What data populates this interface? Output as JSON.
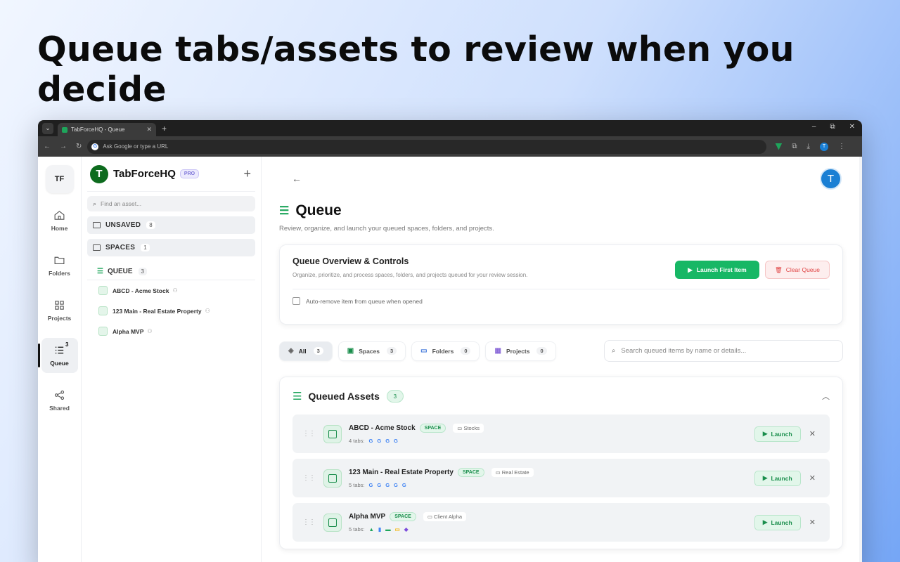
{
  "headline": "Queue tabs/assets to review when you decide",
  "browser": {
    "tab_title": "TabForceHQ - Queue",
    "tab_close": "✕",
    "new_tab": "+",
    "omnibox_placeholder": "Ask Google or type a URL",
    "avatar_initial": "T",
    "window_controls": [
      "–",
      "⧉",
      "✕"
    ]
  },
  "rail": {
    "logo": "TF",
    "items": [
      {
        "label": "Home",
        "icon": "home-icon"
      },
      {
        "label": "Folders",
        "icon": "folder-icon"
      },
      {
        "label": "Projects",
        "icon": "grid-icon"
      },
      {
        "label": "Queue",
        "icon": "list-icon",
        "badge": "3",
        "active": true
      },
      {
        "label": "Shared",
        "icon": "share-icon"
      }
    ]
  },
  "sidebar": {
    "brand": "TabForceHQ",
    "brand_logo": "T",
    "pro": "PRO",
    "add": "+",
    "search_placeholder": "Find an asset...",
    "groups": [
      {
        "label": "UNSAVED",
        "count": "8"
      },
      {
        "label": "SPACES",
        "count": "1"
      }
    ],
    "queue": {
      "label": "QUEUE",
      "count": "3"
    },
    "queue_items": [
      "ABCD - Acme Stock",
      "123 Main - Real Estate Property",
      "Alpha MVP"
    ]
  },
  "main": {
    "back": "←",
    "user_initial": "T",
    "title": "Queue",
    "subtitle": "Review, organize, and launch your queued spaces, folders, and projects.",
    "controls": {
      "title": "Queue Overview & Controls",
      "desc": "Organize, prioritize, and process spaces, folders, and projects queued for your review session.",
      "launch_first": "Launch First Item",
      "clear": "Clear Queue",
      "auto_remove": "Auto-remove item from queue when opened"
    },
    "filters": [
      {
        "label": "All",
        "count": "3",
        "icon": "layers-icon"
      },
      {
        "label": "Spaces",
        "count": "3",
        "icon": "space-icon"
      },
      {
        "label": "Folders",
        "count": "0",
        "icon": "folder-icon"
      },
      {
        "label": "Projects",
        "count": "0",
        "icon": "grid-icon"
      }
    ],
    "search_placeholder": "Search queued items by name or details...",
    "queued": {
      "title": "Queued Assets",
      "count": "3",
      "items": [
        {
          "name": "ABCD - Acme Stock",
          "type": "SPACE",
          "folder": "Stocks",
          "tabs": "4 tabs:",
          "favicons": [
            "G",
            "G",
            "G",
            "G"
          ]
        },
        {
          "name": "123 Main - Real Estate Property",
          "type": "SPACE",
          "folder": "Real Estate",
          "tabs": "5 tabs:",
          "favicons": [
            "G",
            "G",
            "G",
            "G",
            "G"
          ]
        },
        {
          "name": "Alpha MVP",
          "type": "SPACE",
          "folder": "Client Alpha",
          "tabs": "5 tabs:",
          "favicons": [
            "▲",
            "▮",
            "▬",
            "▭",
            "◆"
          ]
        }
      ],
      "launch": "Launch"
    }
  },
  "colors": {
    "accent": "#17b765",
    "danger": "#e04545",
    "avatar": "#1a7fd4"
  }
}
